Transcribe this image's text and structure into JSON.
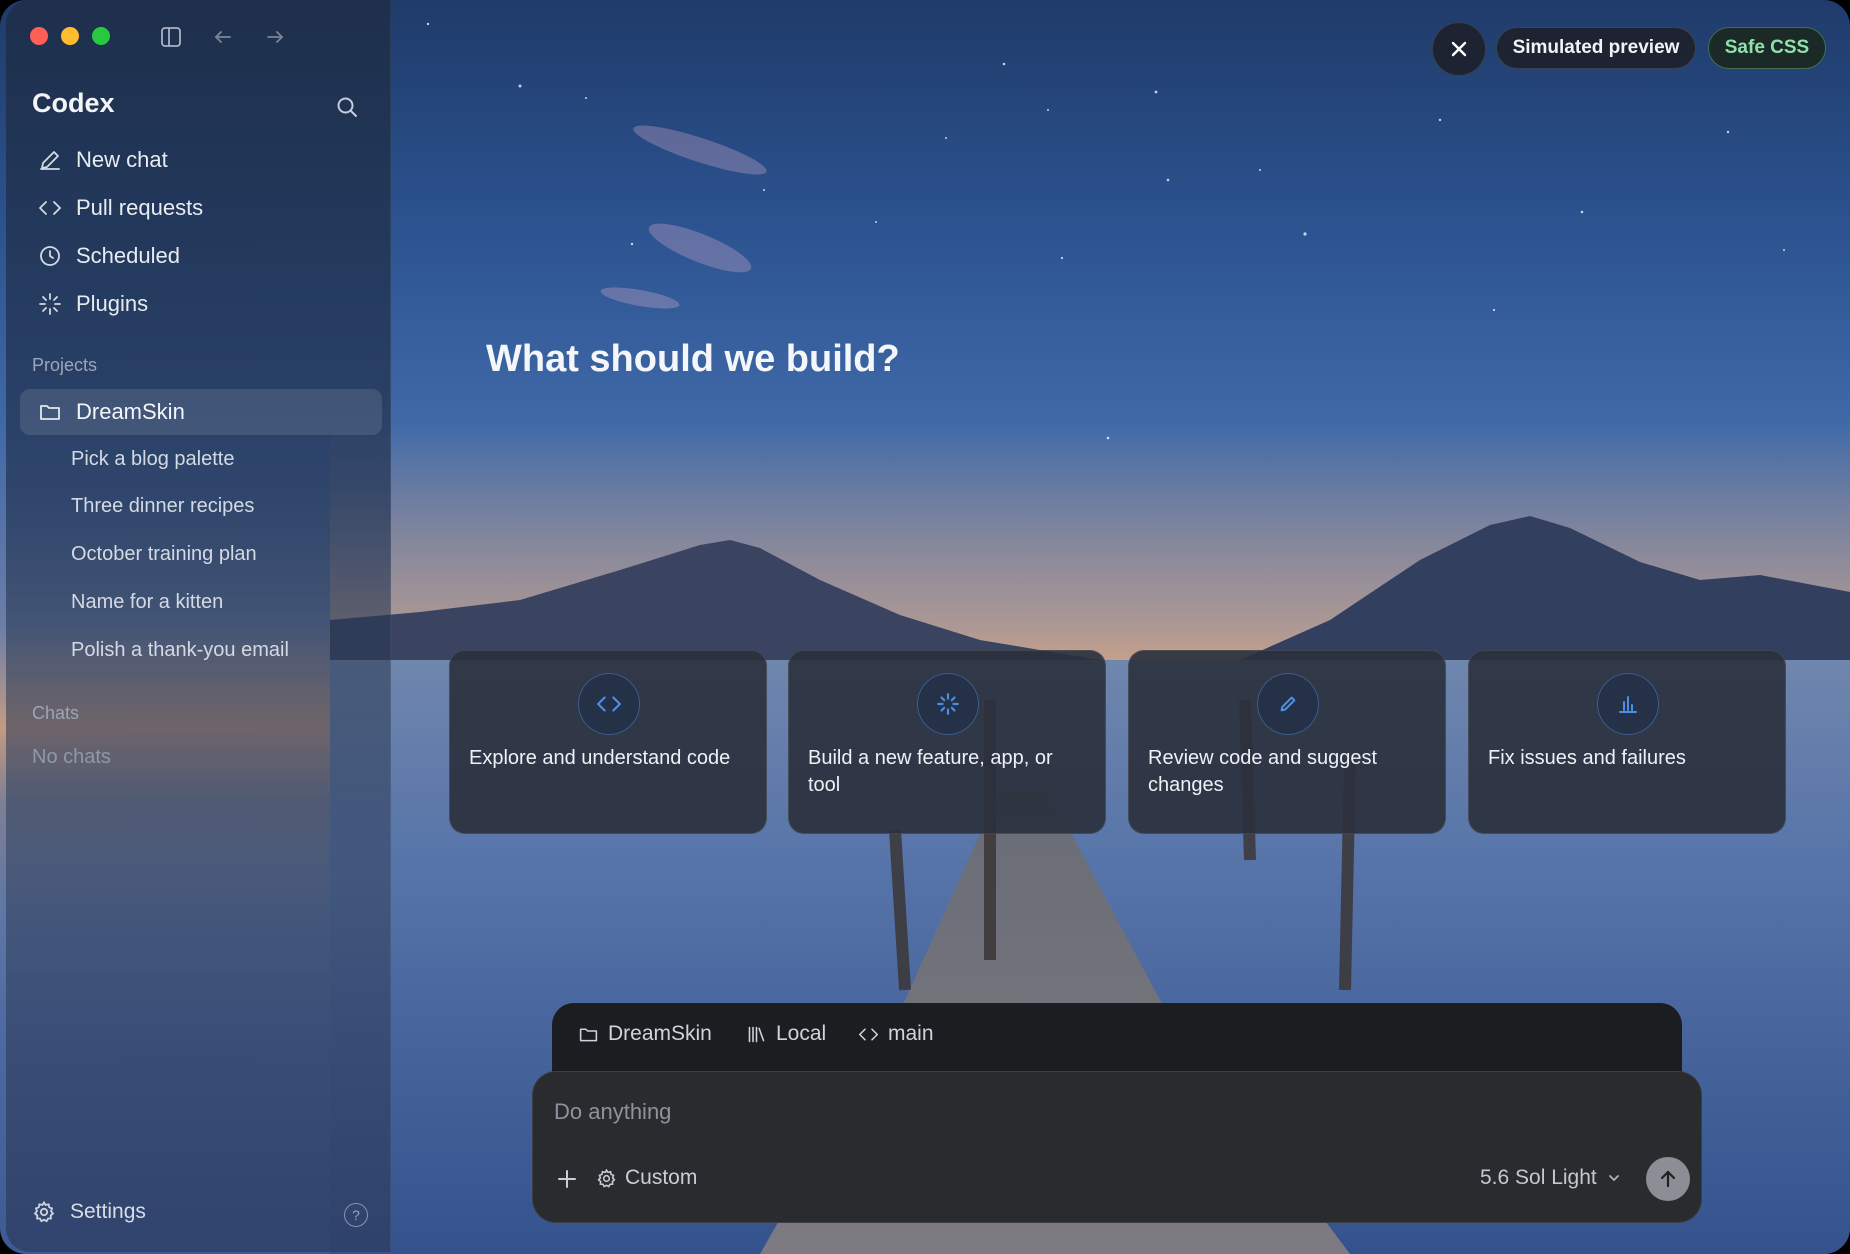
{
  "window": {
    "sidebar_toggle_icon": "sidebar-toggle-icon",
    "back_icon": "arrow-left-icon",
    "forward_icon": "arrow-right-icon"
  },
  "sidebar": {
    "app_title": "Codex",
    "search_icon": "search-icon",
    "nav": [
      {
        "label": "New chat",
        "icon": "pencil-icon"
      },
      {
        "label": "Pull requests",
        "icon": "code-icon"
      },
      {
        "label": "Scheduled",
        "icon": "clock-icon"
      },
      {
        "label": "Plugins",
        "icon": "sparkle-icon"
      }
    ],
    "projects_label": "Projects",
    "project": {
      "label": "DreamSkin",
      "icon": "folder-icon"
    },
    "threads": [
      "Pick a blog palette",
      "Three dinner recipes",
      "October training plan",
      "Name for a kitten",
      "Polish a thank-you email"
    ],
    "chats_label": "Chats",
    "no_chats": "No chats",
    "settings_label": "Settings",
    "help_label": "?"
  },
  "topbar": {
    "close_icon": "close-icon",
    "preview_label": "Simulated preview",
    "css_label": "Safe CSS",
    "css_color": "#8fe0a9"
  },
  "main": {
    "hero_title": "What should we build?",
    "cards": [
      {
        "label": "Explore and understand code",
        "icon": "code-icon"
      },
      {
        "label": "Build a new feature, app, or tool",
        "icon": "sparkle-icon"
      },
      {
        "label": "Review code and suggest changes",
        "icon": "pencil-icon"
      },
      {
        "label": "Fix issues and failures",
        "icon": "bar-chart-icon"
      }
    ],
    "accent_color": "#4d8ee8"
  },
  "composer": {
    "context": {
      "project": "DreamSkin",
      "environment": "Local",
      "branch": "main"
    },
    "placeholder": "Do anything",
    "value": "",
    "custom_label": "Custom",
    "model_label": "5.6 Sol Light",
    "send_icon": "arrow-up-icon"
  }
}
